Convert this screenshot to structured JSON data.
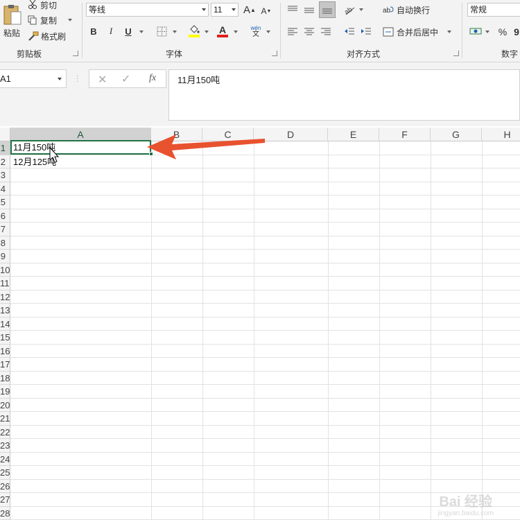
{
  "clipboard": {
    "paste_label": "粘贴",
    "cut_label": "剪切",
    "copy_label": "复制",
    "format_painter_label": "格式刷",
    "group_label": "剪贴板"
  },
  "font": {
    "name": "等线",
    "size": "11",
    "bold_label": "B",
    "italic_label": "I",
    "underline_label": "U",
    "grow_label": "A",
    "shrink_label": "A",
    "wen_label": "wén",
    "group_label": "字体"
  },
  "alignment": {
    "wrap_text_label": "自动换行",
    "merge_center_label": "合并后居中",
    "group_label": "对齐方式"
  },
  "number": {
    "format": "常规",
    "percent_label": "%",
    "comma_label": "9",
    "group_label": "数字"
  },
  "formula_bar": {
    "name_box": "A1",
    "fx_label": "fx",
    "formula": "11月150吨"
  },
  "columns": [
    "A",
    "B",
    "C",
    "D",
    "E",
    "F",
    "G",
    "H"
  ],
  "rows": [
    "1",
    "2",
    "3",
    "4",
    "5",
    "6",
    "7",
    "8",
    "9",
    "10",
    "11",
    "12",
    "13",
    "14",
    "15",
    "16",
    "17",
    "18",
    "19",
    "20",
    "21",
    "22",
    "23",
    "24",
    "25",
    "26",
    "27",
    "28"
  ],
  "cells": {
    "A1": "11月150吨",
    "A2": "12月125吨"
  },
  "watermark": {
    "text": "Bai 经验",
    "sub": "jingyan.baidu.com"
  },
  "colors": {
    "accent": "#217346",
    "annotation_arrow": "#e8522f"
  }
}
